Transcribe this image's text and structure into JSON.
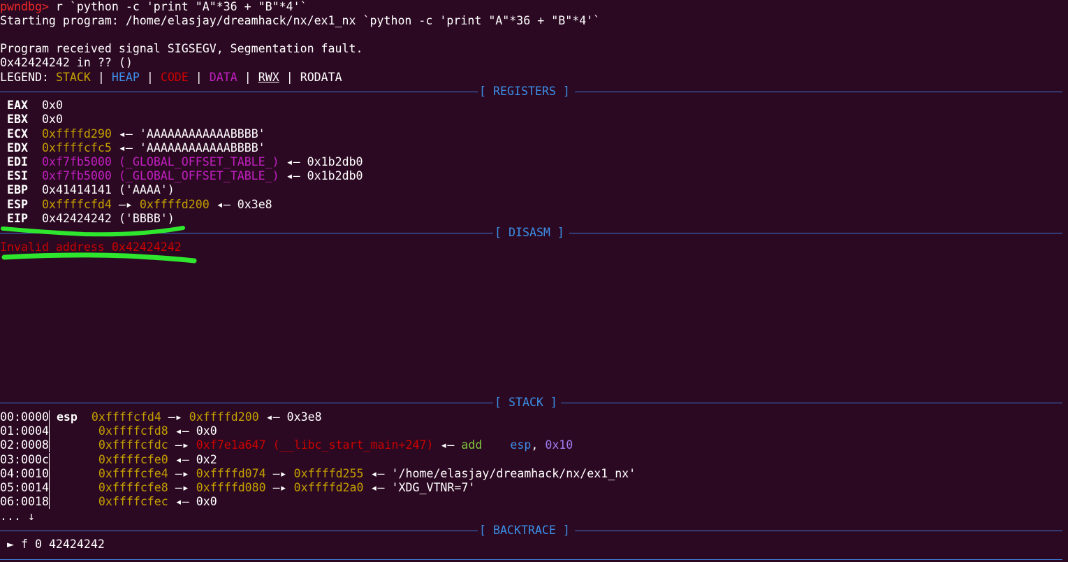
{
  "command": {
    "prompt": "pwndbg>",
    "text": " r `python -c 'print \"A\"*36 + \"B\"*4'`"
  },
  "starting": "Starting program: /home/elasjay/dreamhack/nx/ex1_nx `python -c 'print \"A\"*36 + \"B\"*4'`",
  "signal": "Program received signal SIGSEGV, Segmentation fault.",
  "location": "0x42424242 in ?? ()",
  "legend": {
    "prefix": "LEGEND: ",
    "items": [
      "STACK",
      "HEAP",
      "CODE",
      "DATA",
      "RWX",
      "RODATA"
    ],
    "sep": " | "
  },
  "headers": {
    "registers": "[ REGISTERS ]",
    "disasm": "[ DISASM ]",
    "stack": "[ STACK ]",
    "backtrace": "[ BACKTRACE ]"
  },
  "registers": [
    {
      "name": "EAX",
      "value": "0x0"
    },
    {
      "name": "EBX",
      "value": "0x0"
    },
    {
      "name": "ECX",
      "value": "0xffffd290",
      "arrow": " ◂— ",
      "target": "'AAAAAAAAAAAABBBB'"
    },
    {
      "name": "EDX",
      "value": "0xffffcfc5",
      "arrow": " ◂— ",
      "target": "'AAAAAAAAAAAABBBB'"
    },
    {
      "name": "EDI",
      "value": "0xf7fb5000",
      "symbol": " (_GLOBAL_OFFSET_TABLE_)",
      "arrow": " ◂— ",
      "target": "0x1b2db0"
    },
    {
      "name": "ESI",
      "value": "0xf7fb5000",
      "symbol": " (_GLOBAL_OFFSET_TABLE_)",
      "arrow": " ◂— ",
      "target": "0x1b2db0"
    },
    {
      "name": "EBP",
      "value": "0x41414141",
      "target": " ('AAAA')"
    },
    {
      "name": "ESP",
      "value": "0xffffcfd4",
      "arrow": " —▸ ",
      "value2": "0xffffd200",
      "arrow2": " ◂— ",
      "target": "0x3e8"
    },
    {
      "name": "EIP",
      "value": "0x42424242",
      "target": " ('BBBB')"
    }
  ],
  "disasm": {
    "error": "Invalid address 0x42424242"
  },
  "stack": [
    {
      "offset": "00:0000",
      "reg": "esp",
      "addr": "0xffffcfd4",
      "arrow": " —▸ ",
      "p1": "0xffffd200",
      "arrow2": " ◂— ",
      "val": "0x3e8"
    },
    {
      "offset": "01:0004",
      "reg": "",
      "addr": "0xffffcfd8",
      "arrow": " ◂— ",
      "val": "0x0"
    },
    {
      "offset": "02:0008",
      "reg": "",
      "addr": "0xffffcfdc",
      "arrow": " —▸ ",
      "p1": "0xf7e1a647",
      "sym": " (__libc_start_main+247)",
      "arrow2": " ◂— ",
      "ins": "add",
      "ins_op1": "esp",
      "ins_sep": ", ",
      "ins_op2": "0x10"
    },
    {
      "offset": "03:000c",
      "reg": "",
      "addr": "0xffffcfe0",
      "arrow": " ◂— ",
      "val": "0x2"
    },
    {
      "offset": "04:0010",
      "reg": "",
      "addr": "0xffffcfe4",
      "arrow": " —▸ ",
      "p1": "0xffffd074",
      "arrow2": " —▸ ",
      "p2": "0xffffd255",
      "arrow3": " ◂— ",
      "val": "'/home/elasjay/dreamhack/nx/ex1_nx'"
    },
    {
      "offset": "05:0014",
      "reg": "",
      "addr": "0xffffcfe8",
      "arrow": " —▸ ",
      "p1": "0xffffd080",
      "arrow2": " —▸ ",
      "p2": "0xffffd2a0",
      "arrow3": " ◂— ",
      "val": "'XDG_VTNR=7'"
    },
    {
      "offset": "06:0018",
      "reg": "",
      "addr": "0xffffcfec",
      "arrow": " ◂— ",
      "val": "0x0"
    }
  ],
  "stack_more": "... ↓",
  "backtrace": {
    "marker": " ► ",
    "frame": "f 0 42424242"
  },
  "colors": {
    "background": "#2c0922",
    "stack": "#c4a000",
    "heap": "#3d8ee8",
    "code": "#cc0000",
    "data": "#c120c1",
    "header": "#3a8ee6",
    "highlight": "#2ee62e"
  }
}
